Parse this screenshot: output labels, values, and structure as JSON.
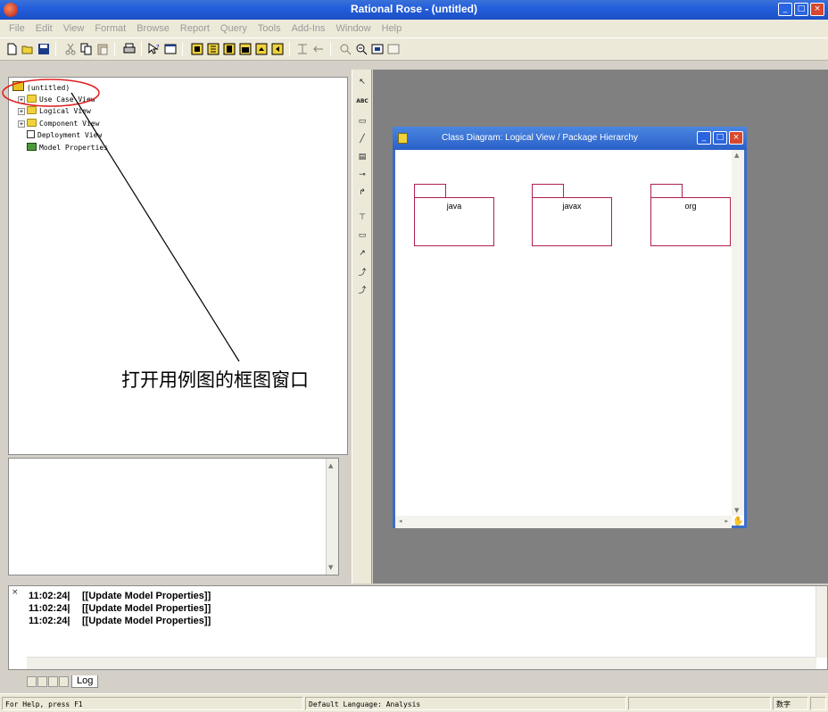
{
  "window": {
    "title": "Rational Rose - (untitled)",
    "controls": {
      "minimize": "_",
      "maximize": "□",
      "close": "×"
    }
  },
  "menu": [
    "File",
    "Edit",
    "View",
    "Format",
    "Browse",
    "Report",
    "Query",
    "Tools",
    "Add-Ins",
    "Window",
    "Help"
  ],
  "toolbar": {
    "icons": [
      "new-icon",
      "open-icon",
      "save-icon",
      "cut-icon",
      "copy-icon",
      "paste-icon",
      "print-icon",
      "context-help-icon",
      "view-doc-icon",
      "browse-class-diagram-icon",
      "browse-interaction-diagram-icon",
      "browse-component-diagram-icon",
      "browse-deployment-diagram-icon",
      "browse-parent-icon",
      "browse-previous-icon",
      "zoom-in-icon",
      "zoom-out-icon",
      "fit-in-window-icon",
      "undo-fit-icon"
    ]
  },
  "browser": {
    "root": "(untitled)",
    "items": [
      {
        "label": "Use Case View",
        "expander": "+"
      },
      {
        "label": "Logical View",
        "expander": "+"
      },
      {
        "label": "Component View",
        "expander": "+"
      },
      {
        "label": "Deployment View",
        "expander": ""
      },
      {
        "label": "Model Properties",
        "expander": ""
      }
    ]
  },
  "diagram_toolbox": {
    "tools": [
      {
        "name": "selection-tool",
        "glyph": "↖"
      },
      {
        "name": "text-box-tool",
        "glyph": "ABC"
      },
      {
        "name": "note-tool",
        "glyph": "▭"
      },
      {
        "name": "anchor-note-tool",
        "glyph": "╱"
      },
      {
        "name": "class-tool",
        "glyph": "▤"
      },
      {
        "name": "interface-tool",
        "glyph": "⊸"
      },
      {
        "name": "unidirectional-association-tool",
        "glyph": "↱"
      },
      {
        "name": "association-class-tool",
        "glyph": "⊤"
      },
      {
        "name": "package-tool",
        "glyph": "▭"
      },
      {
        "name": "dependency-tool",
        "glyph": "↗"
      },
      {
        "name": "generalization-tool",
        "glyph": "⤴"
      },
      {
        "name": "realize-tool",
        "glyph": "⤴"
      }
    ]
  },
  "diagram_window": {
    "title": "Class Diagram: Logical View / Package Hierarchy",
    "packages": [
      "java",
      "javax",
      "org"
    ]
  },
  "annotation": "打开用例图的框图窗口",
  "log": {
    "close": "×",
    "lines": [
      {
        "time": "11:02:24|",
        "message": "[[Update Model Properties]]"
      },
      {
        "time": "11:02:24|",
        "message": "[[Update Model Properties]]"
      },
      {
        "time": "11:02:24|",
        "message": "[[Update Model Properties]]"
      }
    ],
    "tab": "Log"
  },
  "status": {
    "help": "For Help, press F1",
    "language": "Default Language: Analysis",
    "mode": "数字"
  },
  "colors": {
    "titlebar": "#245edc",
    "workspace": "#808080",
    "package_border": "#b0204a",
    "annotation_circle": "#e02020"
  }
}
